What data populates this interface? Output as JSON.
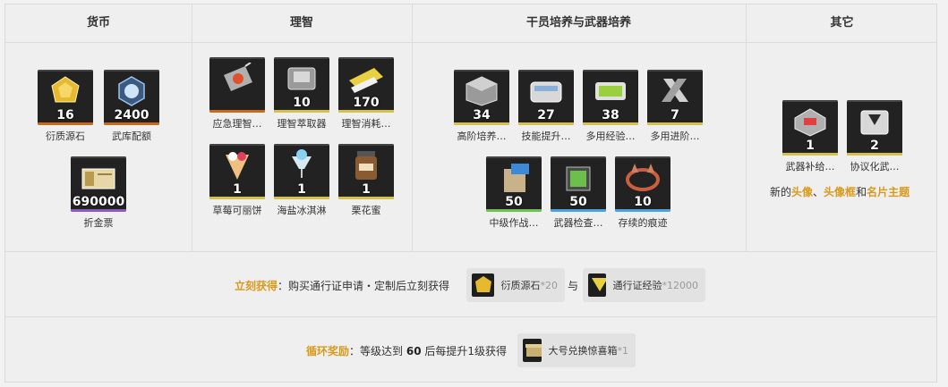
{
  "headers": [
    "货币",
    "理智",
    "干员培养与武器培养",
    "其它"
  ],
  "currency": [
    {
      "label": "衍质源石",
      "qty": "16",
      "bar": "#c96a1a",
      "icon": "originium-icon",
      "color": "#e7b92e"
    },
    {
      "label": "武库配额",
      "qty": "2400",
      "bar": "#c96a1a",
      "icon": "arsenal-quota-icon",
      "color": "#6aa0d8"
    },
    {
      "label": "折金票",
      "qty": "690000",
      "bar": "#8a5cc2",
      "icon": "gold-ticket-icon",
      "color": "#d9c48a"
    }
  ],
  "sanity": [
    {
      "label": "应急理智…",
      "qty": "",
      "bar": "#c96a1a",
      "icon": "emergency-sanity-icon",
      "color": "#b0b0b0"
    },
    {
      "label": "理智萃取器",
      "qty": "10",
      "bar": "#d6c24a",
      "icon": "sanity-extractor-icon",
      "color": "#c8c8c8"
    },
    {
      "label": "理智消耗…",
      "qty": "170",
      "bar": "#d6c24a",
      "icon": "sanity-consume-icon",
      "color": "#e8d040"
    },
    {
      "label": "草莓可丽饼",
      "qty": "1",
      "bar": "#d6c24a",
      "icon": "crepe-icon",
      "color": "#f0c080"
    },
    {
      "label": "海盐冰淇淋",
      "qty": "1",
      "bar": "#d6c24a",
      "icon": "icecream-icon",
      "color": "#d8e8f0"
    },
    {
      "label": "栗花蜜",
      "qty": "1",
      "bar": "#d6c24a",
      "icon": "honey-jar-icon",
      "color": "#8a5a30"
    }
  ],
  "training": [
    {
      "label": "高阶培养…",
      "qty": "34",
      "bar": "#d6c24a",
      "icon": "advanced-cube-icon",
      "color": "#c0c0c0"
    },
    {
      "label": "技能提升…",
      "qty": "27",
      "bar": "#d6c24a",
      "icon": "skill-box-icon",
      "color": "#d8d8d8"
    },
    {
      "label": "多用经验…",
      "qty": "38",
      "bar": "#d6c24a",
      "icon": "exp-battery-icon",
      "color": "#9ad040"
    },
    {
      "label": "多用进阶…",
      "qty": "7",
      "bar": "#d6c24a",
      "icon": "promotion-icon",
      "color": "#d0d0d0"
    },
    {
      "label": "中级作战…",
      "qty": "50",
      "bar": "#6cc24a",
      "icon": "combat-record-icon",
      "color": "#c9b28a"
    },
    {
      "label": "武器检查…",
      "qty": "50",
      "bar": "#4aa0e0",
      "icon": "weapon-check-icon",
      "color": "#6ac04a"
    },
    {
      "label": "存续的痕迹",
      "qty": "10",
      "bar": "#4aa0e0",
      "icon": "crown-trace-icon",
      "color": "#c86040"
    }
  ],
  "other": [
    {
      "label": "武器补给…",
      "qty": "1",
      "bar": "#d6c24a",
      "icon": "weapon-supply-icon",
      "color": "#c0c0c0"
    },
    {
      "label": "协议化武…",
      "qty": "2",
      "bar": "#d6c24a",
      "icon": "protocol-weapon-icon",
      "color": "#d8d8d8"
    }
  ],
  "other_note": {
    "p1": "新的",
    "h1": "头像",
    "p2": "、",
    "h2": "头像框",
    "p3": "和",
    "h3": "名片主题"
  },
  "instant": {
    "tag": "立刻获得",
    "text": "：购买通行证申请・定制后立刻获得",
    "chip1_label": "衍质源石",
    "chip1_mult": "*20",
    "sep": "与",
    "chip2_label": "通行证经验",
    "chip2_mult": "*12000"
  },
  "loop": {
    "tag": "循环奖励",
    "text1": "：等级达到",
    "level": "60",
    "text2": "后每提升1级获得",
    "chip_label": "大号兑换惊喜箱",
    "chip_mult": "*1"
  }
}
